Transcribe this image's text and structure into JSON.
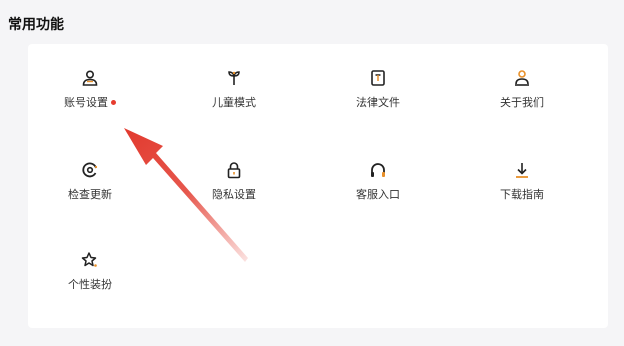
{
  "section": {
    "title": "常用功能"
  },
  "items": [
    {
      "label": "账号设置",
      "icon": "person-icon",
      "badge": true
    },
    {
      "label": "儿童模式",
      "icon": "sprout-icon"
    },
    {
      "label": "法律文件",
      "icon": "document-icon"
    },
    {
      "label": "关于我们",
      "icon": "people-icon"
    },
    {
      "label": "检查更新",
      "icon": "refresh-icon"
    },
    {
      "label": "隐私设置",
      "icon": "lock-icon"
    },
    {
      "label": "客服入口",
      "icon": "headset-icon"
    },
    {
      "label": "下载指南",
      "icon": "download-icon"
    },
    {
      "label": "个性装扮",
      "icon": "sparkle-icon"
    }
  ],
  "colors": {
    "accent": "#e8902a",
    "badge": "#e63b2e",
    "arrow": "#e23a2e",
    "icon": "#222222"
  }
}
